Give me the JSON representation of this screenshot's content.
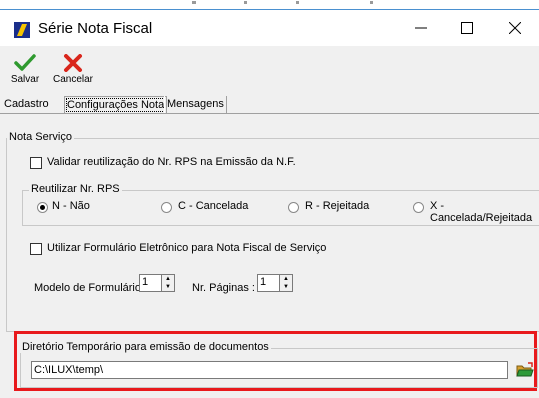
{
  "window": {
    "title": "Série Nota Fiscal"
  },
  "toolbar": {
    "save_label": "Salvar",
    "cancel_label": "Cancelar"
  },
  "tabs": [
    {
      "label": "Cadastro",
      "active": false
    },
    {
      "label": "Configurações Nota",
      "active": true
    },
    {
      "label": "Mensagens",
      "active": false
    }
  ],
  "nota_servico": {
    "legend": "Nota Serviço",
    "validar_label": "Validar reutilização do Nr. RPS na Emissão da N.F.",
    "validar_checked": false,
    "reutilizar": {
      "legend": "Reutilizar Nr. RPS",
      "options": [
        {
          "label": "N - Não",
          "selected": true
        },
        {
          "label": "C - Cancelada",
          "selected": false
        },
        {
          "label": "R - Rejeitada",
          "selected": false
        },
        {
          "label": "X - Cancelada/Rejeitada",
          "selected": false
        }
      ]
    },
    "formulario_label": "Utilizar Formulário Eletrônico para Nota Fiscal de Serviço",
    "formulario_checked": false,
    "modelo_label": "Modelo de Formulário :",
    "modelo_value": "1",
    "paginas_label": "Nr. Páginas :",
    "paginas_value": "1"
  },
  "diretorio": {
    "legend": "Diretório Temporário para emissão de documentos",
    "value": "C:\\ILUX\\temp\\"
  },
  "colors": {
    "highlight": "#e8191c",
    "accent": "#4a90d0"
  }
}
